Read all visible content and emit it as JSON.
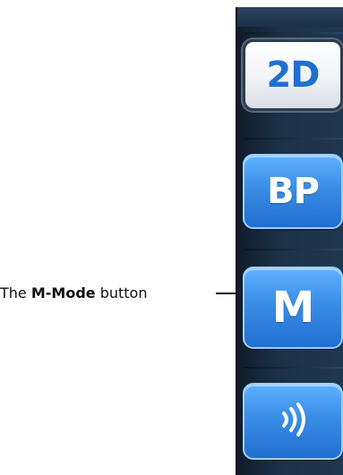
{
  "toolbar": {
    "buttons": [
      {
        "id": "2d",
        "label": "2D",
        "state": "active"
      },
      {
        "id": "bp",
        "label": "BP",
        "state": "normal"
      },
      {
        "id": "m-mode",
        "label": "M",
        "state": "normal"
      },
      {
        "id": "audio",
        "icon": "sound-waves-icon",
        "label": "",
        "state": "normal"
      }
    ]
  },
  "callout": {
    "prefix": "The ",
    "bold": "M-Mode",
    "suffix": " button"
  },
  "colors": {
    "panel_bg": "#1c3148",
    "button_blue": "#3a8de6",
    "active_text": "#1f6fd0",
    "active_bg": "#f0f3f6"
  }
}
